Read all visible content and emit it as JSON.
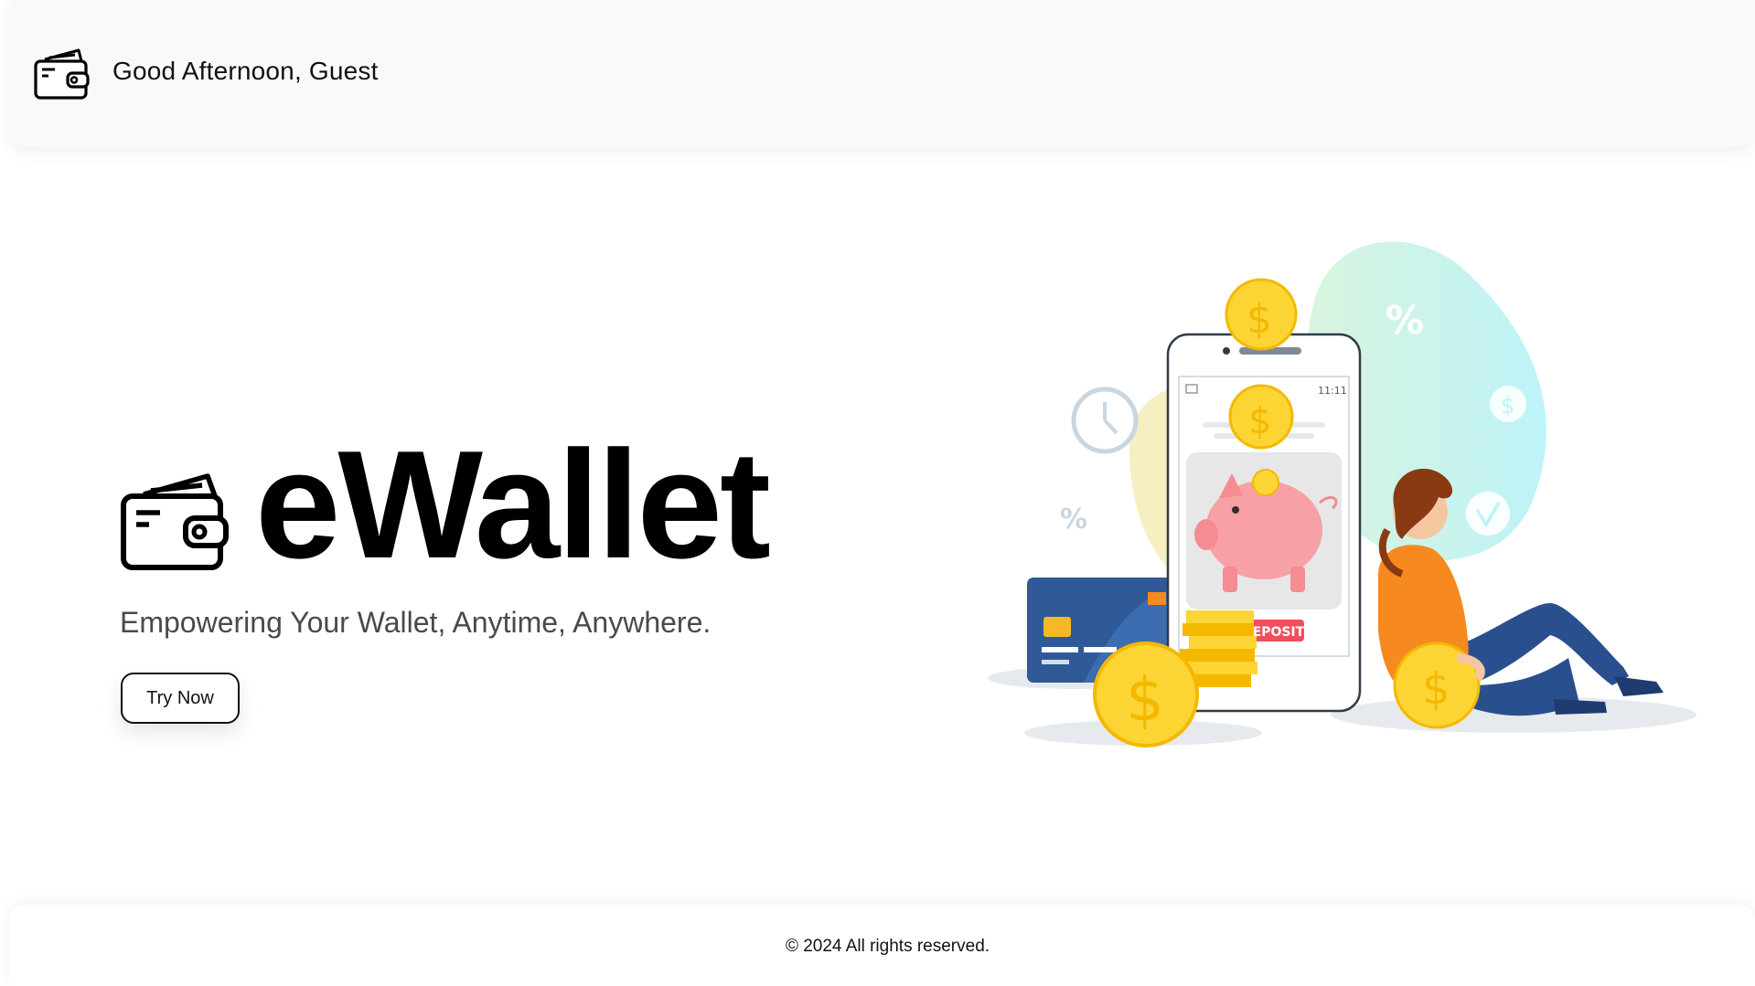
{
  "header": {
    "greeting": "Good Afternoon, Guest",
    "logo_icon": "wallet-icon"
  },
  "hero": {
    "brand_icon": "wallet-icon",
    "title": "eWallet",
    "tagline": "Empowering Your Wallet, Anytime, Anywhere.",
    "cta_label": "Try Now"
  },
  "illustration": {
    "phone_time": "11:11",
    "deposit_label": "DEPOSIT",
    "percent_symbol": "%",
    "dollar_symbol": "$",
    "colors": {
      "coin": "#fcd535",
      "coin_edge": "#f5b800",
      "piggy": "#f7a1a6",
      "deposit": "#ef4f5d",
      "card": "#2f5a97",
      "shirt": "#f6891f",
      "jeans": "#2a4f8f",
      "blob": "#bff3f7",
      "blob_yellow": "#f6efc1"
    }
  },
  "footer": {
    "copyright": "© 2024 All rights reserved."
  }
}
